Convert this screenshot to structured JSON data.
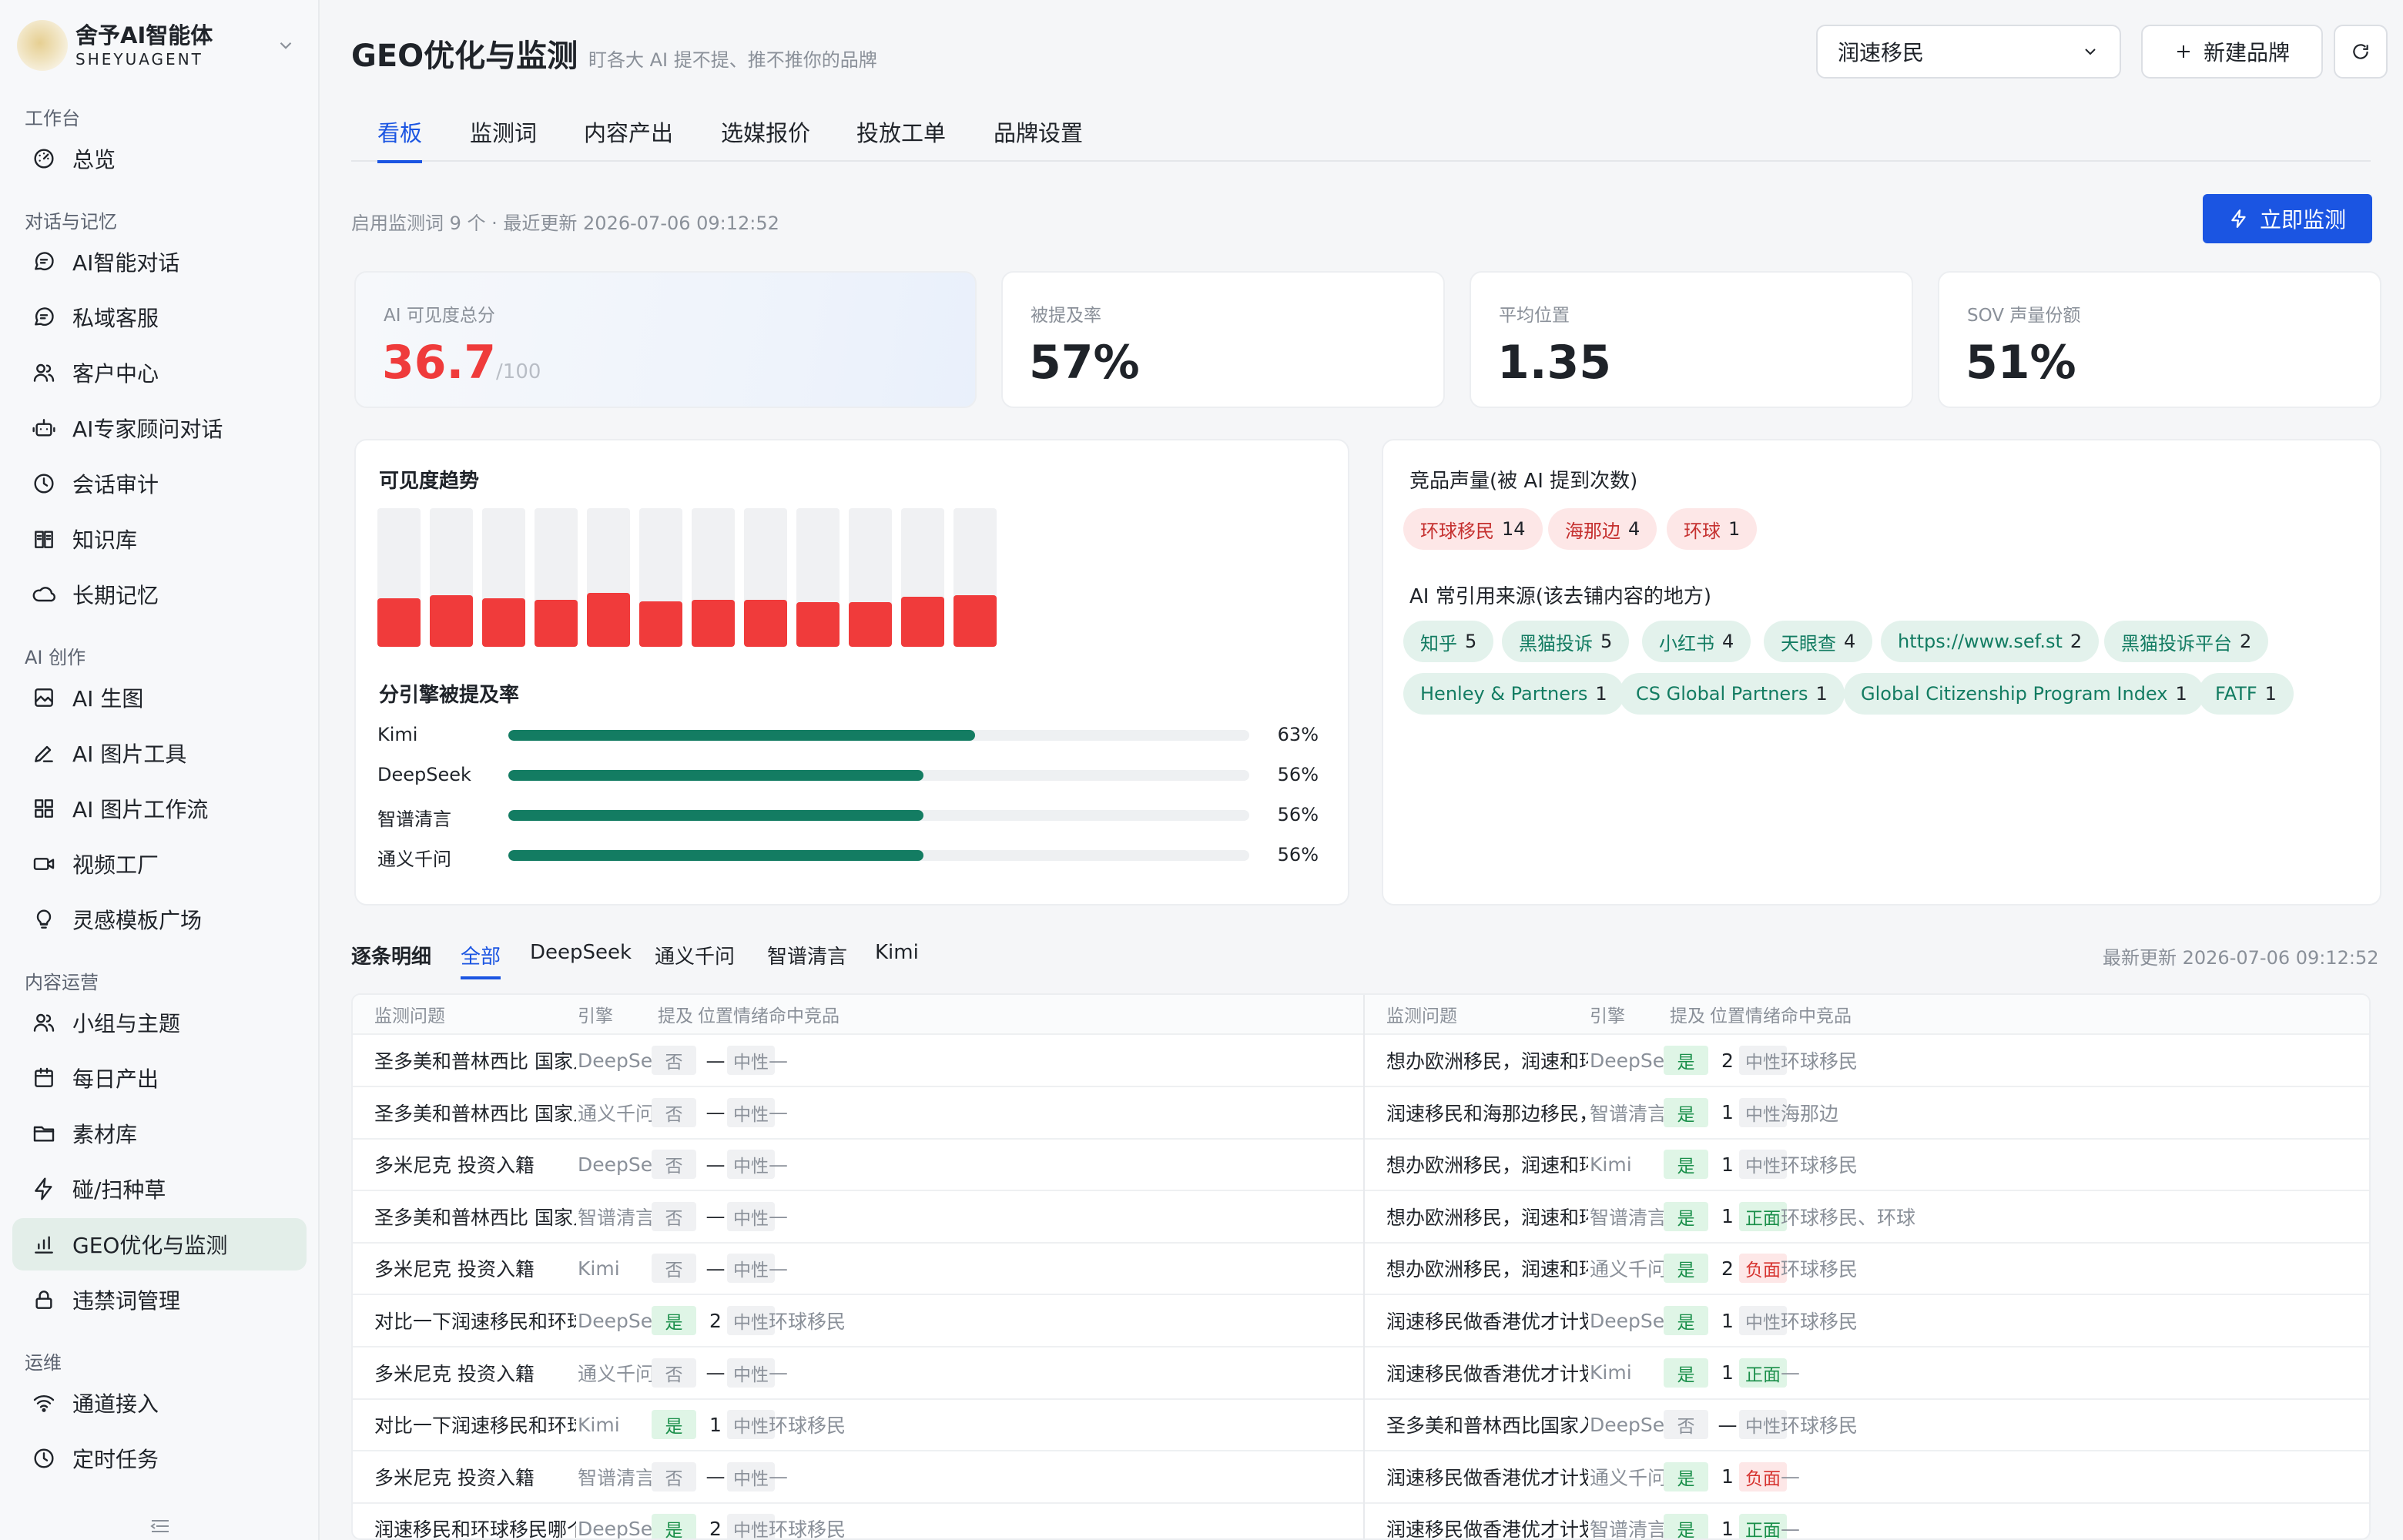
{
  "sidebar": {
    "brand_name": "舍予AI智能体",
    "brand_sub": "SHEYUAGENT",
    "sections": [
      {
        "label": "工作台",
        "items": [
          {
            "label": "总览",
            "icon": "dashboard-icon"
          }
        ]
      },
      {
        "label": "对话与记忆",
        "items": [
          {
            "label": "AI智能对话",
            "icon": "chat-icon"
          },
          {
            "label": "私域客服",
            "icon": "chat-icon"
          },
          {
            "label": "客户中心",
            "icon": "users-icon"
          },
          {
            "label": "AI专家顾问对话",
            "icon": "robot-icon"
          },
          {
            "label": "会话审计",
            "icon": "history-icon"
          },
          {
            "label": "知识库",
            "icon": "book-icon"
          },
          {
            "label": "长期记忆",
            "icon": "cloud-icon"
          }
        ]
      },
      {
        "label": "AI 创作",
        "items": [
          {
            "label": "AI 生图",
            "icon": "image-icon"
          },
          {
            "label": "AI 图片工具",
            "icon": "pen-icon"
          },
          {
            "label": "AI 图片工作流",
            "icon": "grid-icon"
          },
          {
            "label": "视频工厂",
            "icon": "video-icon"
          },
          {
            "label": "灵感模板广场",
            "icon": "bulb-icon"
          }
        ]
      },
      {
        "label": "内容运营",
        "items": [
          {
            "label": "小组与主题",
            "icon": "users-icon"
          },
          {
            "label": "每日产出",
            "icon": "calendar-icon"
          },
          {
            "label": "素材库",
            "icon": "folder-icon"
          },
          {
            "label": "碰/扫种草",
            "icon": "bolt-icon"
          },
          {
            "label": "GEO优化与监测",
            "icon": "bar-chart-icon",
            "active": true
          },
          {
            "label": "违禁词管理",
            "icon": "lock-icon"
          }
        ]
      },
      {
        "label": "运维",
        "items": [
          {
            "label": "通道接入",
            "icon": "wifi-icon"
          },
          {
            "label": "定时任务",
            "icon": "clock-icon"
          }
        ]
      }
    ]
  },
  "header": {
    "title": "GEO优化与监测",
    "subtitle": "盯各大 AI 提不提、推不推你的品牌",
    "brand_select": "润速移民",
    "new_brand": "新建品牌"
  },
  "tabs": [
    "看板",
    "监测词",
    "内容产出",
    "选媒报价",
    "投放工单",
    "品牌设置"
  ],
  "active_tab": "看板",
  "meta": "启用监测词 9 个 · 最近更新 2026-07-06 09:12:52",
  "monitor_button": "立即监测",
  "stats": {
    "score_label": "AI 可见度总分",
    "score": "36.7",
    "score_unit": "/100",
    "mention_label": "被提及率",
    "mention": "57%",
    "position_label": "平均位置",
    "position": "1.35",
    "sov_label": "SOV 声量份额",
    "sov": "51%"
  },
  "trend": {
    "title": "可见度趋势",
    "values": [
      0.35,
      0.37,
      0.35,
      0.34,
      0.39,
      0.33,
      0.34,
      0.34,
      0.32,
      0.32,
      0.36,
      0.37
    ]
  },
  "engines": {
    "title": "分引擎被提及率",
    "items": [
      {
        "name": "Kimi",
        "value": 63,
        "label": "63%"
      },
      {
        "name": "DeepSeek",
        "value": 56,
        "label": "56%"
      },
      {
        "name": "智谱清言",
        "value": 56,
        "label": "56%"
      },
      {
        "name": "通义千问",
        "value": 56,
        "label": "56%"
      }
    ]
  },
  "competitors": {
    "title": "竞品声量(被 AI 提到次数)",
    "items": [
      {
        "name": "环球移民",
        "count": "14"
      },
      {
        "name": "海那边",
        "count": "4"
      },
      {
        "name": "环球",
        "count": "1"
      }
    ]
  },
  "sources": {
    "title": "AI 常引用来源(该去铺内容的地方)",
    "items": [
      {
        "name": "知乎",
        "count": "5"
      },
      {
        "name": "黑猫投诉",
        "count": "5"
      },
      {
        "name": "小红书",
        "count": "4"
      },
      {
        "name": "天眼查",
        "count": "4"
      },
      {
        "name": "https://www.sef.st",
        "count": "2"
      },
      {
        "name": "黑猫投诉平台",
        "count": "2"
      },
      {
        "name": "Henley & Partners",
        "count": "1"
      },
      {
        "name": "CS Global Partners",
        "count": "1"
      },
      {
        "name": "Global Citizenship Program Index",
        "count": "1"
      },
      {
        "name": "FATF",
        "count": "1"
      }
    ]
  },
  "details": {
    "title": "逐条明细",
    "tabs": [
      "全部",
      "DeepSeek",
      "通义千问",
      "智谱清言",
      "Kimi"
    ],
    "updated": "最新更新 2026-07-06 09:12:52",
    "columns": [
      "监测问题",
      "引擎",
      "提及",
      "位置",
      "情绪",
      "命中竞品"
    ],
    "left_rows": [
      {
        "q": "圣多美和普林西比 国家入籍项目",
        "engine": "DeepSeek",
        "mention": "否",
        "pos": "—",
        "mood": "中性",
        "comp": "—"
      },
      {
        "q": "圣多美和普林西比 国家入籍项目",
        "engine": "通义千问",
        "mention": "否",
        "pos": "—",
        "mood": "中性",
        "comp": "—"
      },
      {
        "q": "多米尼克 投资入籍",
        "engine": "DeepSeek",
        "mention": "否",
        "pos": "—",
        "mood": "中性",
        "comp": "—"
      },
      {
        "q": "圣多美和普林西比 国家入籍项目",
        "engine": "智谱清言",
        "mention": "否",
        "pos": "—",
        "mood": "中性",
        "comp": "—"
      },
      {
        "q": "多米尼克 投资入籍",
        "engine": "Kimi",
        "mention": "否",
        "pos": "—",
        "mood": "中性",
        "comp": "—"
      },
      {
        "q": "对比一下润速移民和环球移民，哪家成功率…",
        "engine": "DeepSeek",
        "mention": "是",
        "pos": "2",
        "mood": "中性",
        "comp": "环球移民"
      },
      {
        "q": "多米尼克 投资入籍",
        "engine": "通义千问",
        "mention": "否",
        "pos": "—",
        "mood": "中性",
        "comp": "—"
      },
      {
        "q": "对比一下润速移民和环球移民，哪家成功率…",
        "engine": "Kimi",
        "mention": "是",
        "pos": "1",
        "mood": "中性",
        "comp": "环球移民"
      },
      {
        "q": "多米尼克 投资入籍",
        "engine": "智谱清言",
        "mention": "否",
        "pos": "—",
        "mood": "中性",
        "comp": "—"
      },
      {
        "q": "润速移民和环球移民哪个好?",
        "engine": "DeepSeek",
        "mention": "是",
        "pos": "2",
        "mood": "中性",
        "comp": "环球移民"
      }
    ],
    "right_rows": [
      {
        "q": "想办欧洲移民，润速和环球哪个更专业?",
        "engine": "DeepSeek",
        "mention": "是",
        "pos": "2",
        "mood": "中性",
        "comp": "环球移民"
      },
      {
        "q": "润速移民和海那边移民，选哪个?",
        "engine": "智谱清言",
        "mention": "是",
        "pos": "1",
        "mood": "中性",
        "comp": "海那边"
      },
      {
        "q": "想办欧洲移民，润速和环球哪个更专业?",
        "engine": "Kimi",
        "mention": "是",
        "pos": "1",
        "mood": "中性",
        "comp": "环球移民"
      },
      {
        "q": "想办欧洲移民，润速和环球哪个更专业?",
        "engine": "智谱清言",
        "mention": "是",
        "pos": "1",
        "mood": "正面",
        "comp": "环球移民、环球"
      },
      {
        "q": "想办欧洲移民，润速和环球哪个更专业?",
        "engine": "通义千问",
        "mention": "是",
        "pos": "2",
        "mood": "负面",
        "comp": "环球移民"
      },
      {
        "q": "润速移民做香港优才计划怎么样?",
        "engine": "DeepSeek",
        "mention": "是",
        "pos": "1",
        "mood": "中性",
        "comp": "环球移民"
      },
      {
        "q": "润速移民做香港优才计划怎么样?",
        "engine": "Kimi",
        "mention": "是",
        "pos": "1",
        "mood": "正面",
        "comp": "—"
      },
      {
        "q": "圣多美和普林西比国家入籍项目中介推荐一…",
        "engine": "DeepSeek",
        "mention": "否",
        "pos": "—",
        "mood": "中性",
        "comp": "环球移民"
      },
      {
        "q": "润速移民做香港优才计划怎么样?",
        "engine": "通义千问",
        "mention": "是",
        "pos": "1",
        "mood": "负面",
        "comp": "—"
      },
      {
        "q": "润速移民做香港优才计划怎么样?",
        "engine": "智谱清言",
        "mention": "是",
        "pos": "1",
        "mood": "正面",
        "comp": "—"
      }
    ]
  }
}
